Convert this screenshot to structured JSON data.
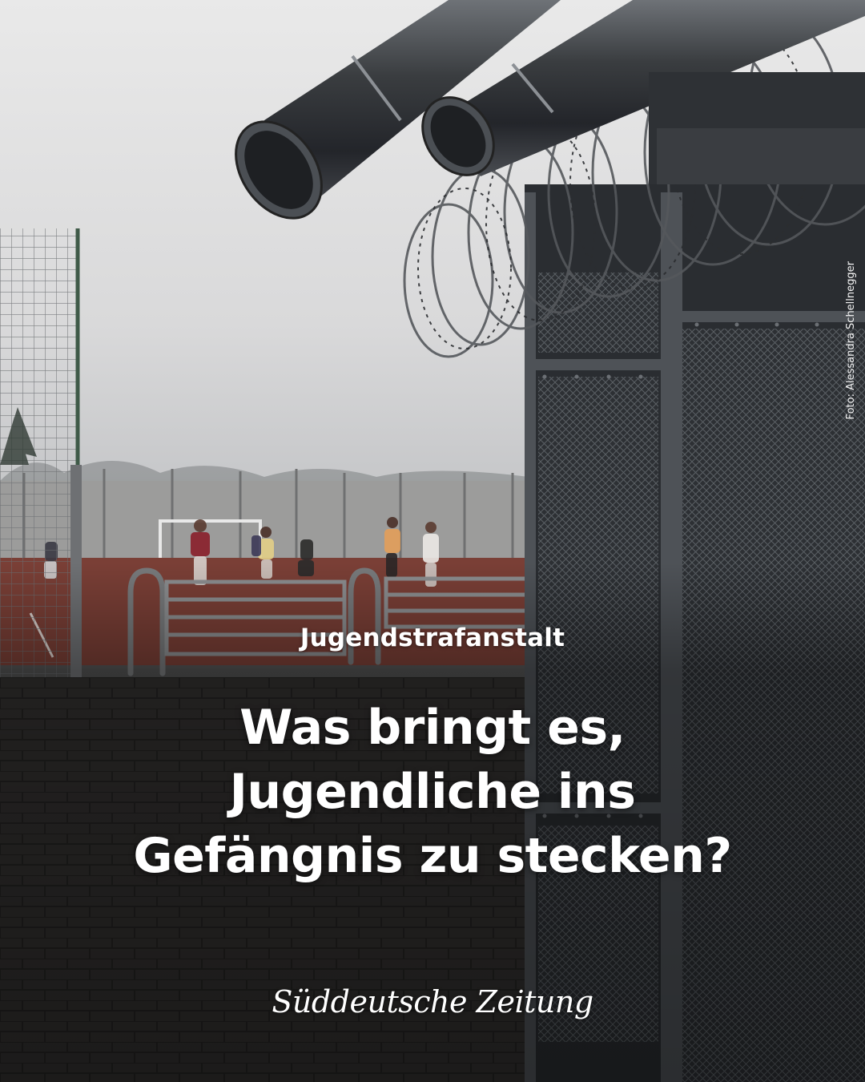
{
  "kicker": "Jugendstrafanstalt",
  "headline": {
    "line1": "Was bringt es,",
    "line2": "Jugendliche ins",
    "line3": "Gefängnis zu stecken?"
  },
  "brand": "Süddeutsche Zeitung",
  "photo_credit": "Foto: Alessandra Schellnegger",
  "colors": {
    "text": "#ffffff",
    "pitch": "#7a3f36",
    "sky": "#dcdcdc",
    "metal": "#3a3d40"
  }
}
